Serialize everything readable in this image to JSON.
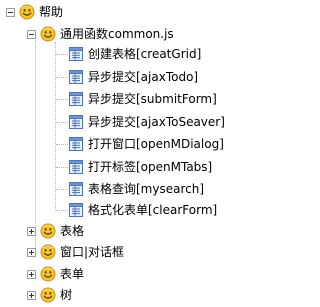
{
  "tree": {
    "root": {
      "label": "帮助",
      "icon": "smiley-folder-icon"
    },
    "group": {
      "label": "通用函数common.js",
      "icon": "smiley-folder-icon"
    },
    "leaves": [
      {
        "label": "创建表格[creatGrid]",
        "icon": "page-icon"
      },
      {
        "label": "异步提交[ajaxTodo]",
        "icon": "page-icon"
      },
      {
        "label": "异步提交[submitForm]",
        "icon": "page-icon"
      },
      {
        "label": "异步提交[ajaxToSeaver]",
        "icon": "page-icon"
      },
      {
        "label": "打开窗口[openMDialog]",
        "icon": "page-icon"
      },
      {
        "label": "打开标签[openMTabs]",
        "icon": "page-icon"
      },
      {
        "label": "表格查询[mysearch]",
        "icon": "page-icon"
      },
      {
        "label": "格式化表单[clearForm]",
        "icon": "page-icon"
      }
    ],
    "collapsed": [
      {
        "label": "表格",
        "icon": "smiley-folder-icon"
      },
      {
        "label": "窗口|对话框",
        "icon": "smiley-folder-icon"
      },
      {
        "label": "表单",
        "icon": "smiley-folder-icon"
      },
      {
        "label": "树",
        "icon": "smiley-folder-icon"
      }
    ]
  }
}
